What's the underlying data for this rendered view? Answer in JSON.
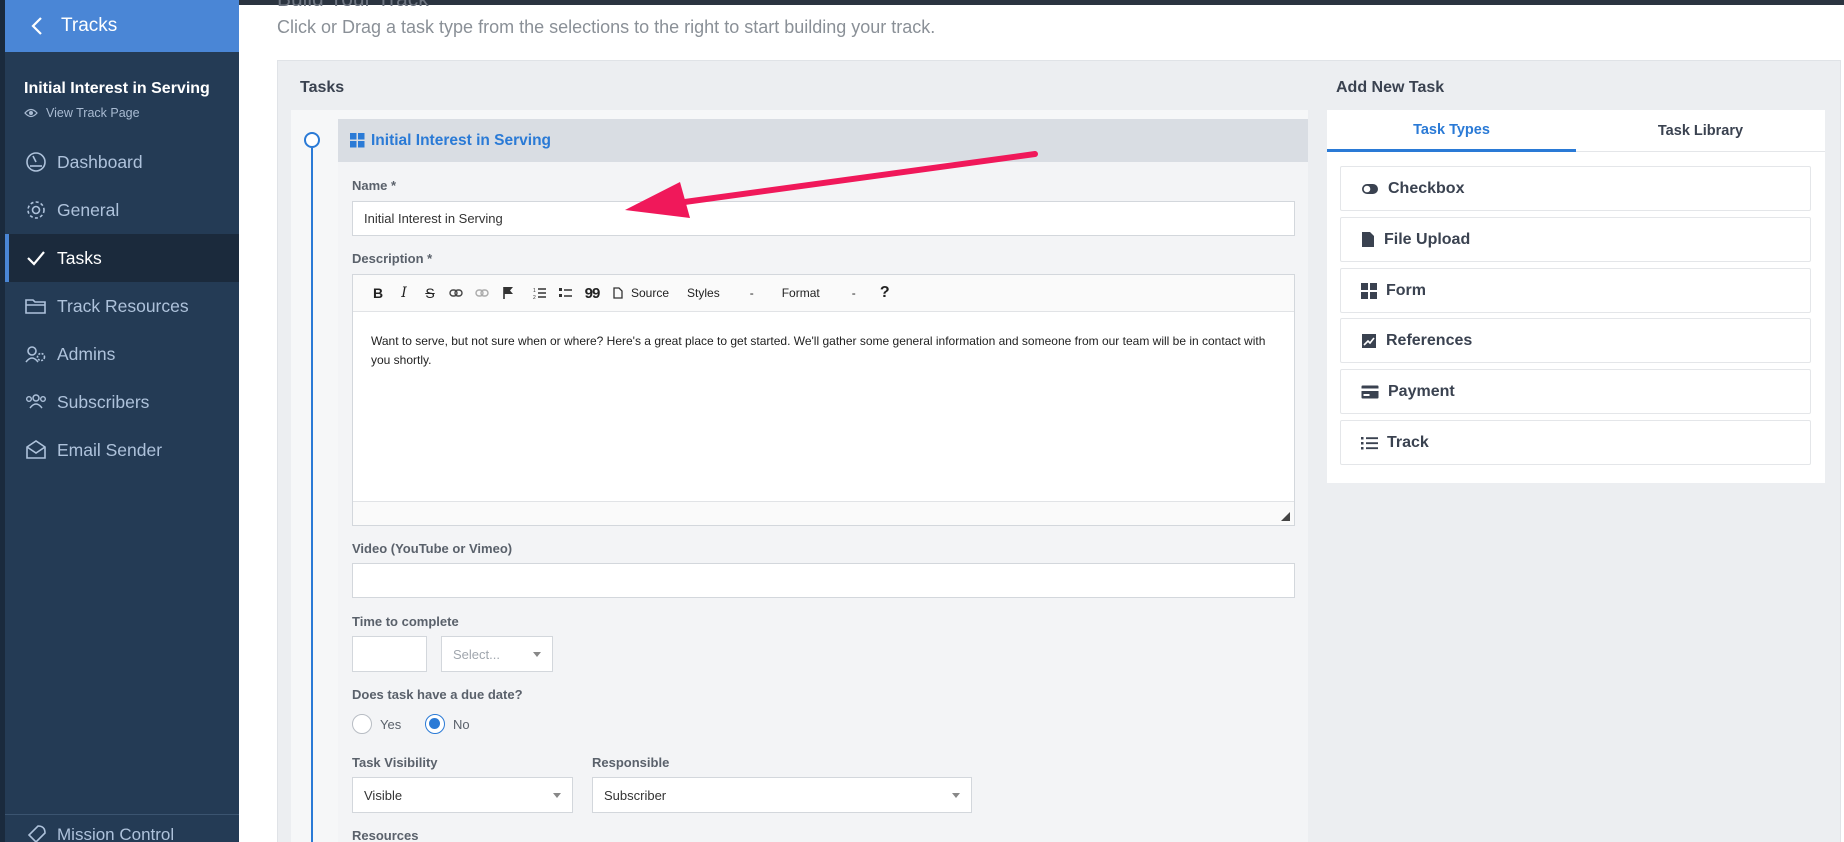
{
  "sidebar": {
    "back_label": "Tracks",
    "track_title": "Initial Interest in Serving",
    "view_track_label": "View Track Page",
    "items": [
      {
        "label": "Dashboard",
        "icon": "dashboard-gauge-icon"
      },
      {
        "label": "General",
        "icon": "gear-icon"
      },
      {
        "label": "Tasks",
        "icon": "check-icon",
        "active": true
      },
      {
        "label": "Track Resources",
        "icon": "folder-icon"
      },
      {
        "label": "Admins",
        "icon": "admins-gear-icon"
      },
      {
        "label": "Subscribers",
        "icon": "users-icon"
      },
      {
        "label": "Email Sender",
        "icon": "envelope-icon"
      }
    ],
    "bottom_item": {
      "label": "Mission Control",
      "icon": "rocket-icon"
    }
  },
  "page": {
    "heading_partial": "Build Your Track",
    "subtitle": "Click or Drag a task type from the selections to the right to start building your track."
  },
  "tasks_panel": {
    "title": "Tasks",
    "task": {
      "header_title": "Initial Interest in Serving",
      "name_label": "Name *",
      "name_value": "Initial Interest in Serving",
      "description_label": "Description *",
      "toolbar": {
        "bold": "B",
        "italic": "I",
        "strike": "S",
        "blockquote": "99",
        "source": "Source",
        "styles": "Styles",
        "styles_dash": "-",
        "format": "Format",
        "format_dash": "-",
        "help": "?"
      },
      "description_text": "Want to serve, but not sure when or where? Here's a great place to get started. We'll gather some general information and someone from our team will be in contact with you shortly.",
      "video_label": "Video (YouTube or Vimeo)",
      "video_value": "",
      "time_label": "Time to complete",
      "time_value": "",
      "time_unit_placeholder": "Select...",
      "due_date_label": "Does task have a due date?",
      "due_yes": "Yes",
      "due_no": "No",
      "due_selected": "No",
      "visibility_label": "Task Visibility",
      "visibility_value": "Visible",
      "responsible_label": "Responsible",
      "responsible_value": "Subscriber",
      "resources_label": "Resources"
    }
  },
  "add_panel": {
    "title": "Add New Task",
    "tabs": [
      {
        "label": "Task Types",
        "active": true
      },
      {
        "label": "Task Library",
        "active": false
      }
    ],
    "types": [
      {
        "label": "Checkbox",
        "icon": "toggle-icon"
      },
      {
        "label": "File Upload",
        "icon": "file-icon"
      },
      {
        "label": "Form",
        "icon": "grid-icon"
      },
      {
        "label": "References",
        "icon": "image-icon"
      },
      {
        "label": "Payment",
        "icon": "credit-card-icon"
      },
      {
        "label": "Track",
        "icon": "list-icon"
      }
    ]
  },
  "colors": {
    "sidebar_bg": "#243b55",
    "accent": "#2a7ad6",
    "back_bar": "#4a86d6",
    "annotation_arrow": "#f0185a"
  }
}
